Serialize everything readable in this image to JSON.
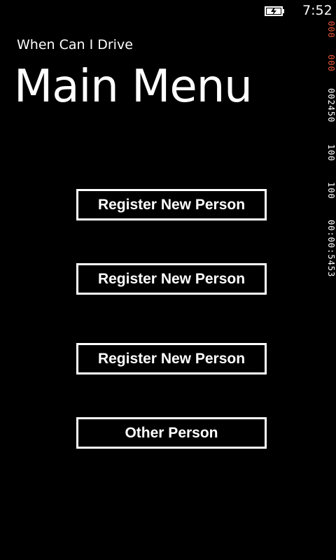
{
  "status_bar": {
    "time": "7:52",
    "battery_icon": "battery-charging-icon"
  },
  "perf_counters": {
    "values": [
      "000",
      "000",
      "002450",
      "100",
      "100",
      "00:00:5453"
    ],
    "colors": {
      "warning": "#e8553a",
      "normal": "#ffffff"
    }
  },
  "header": {
    "app_title": "When Can I Drive",
    "page_title": "Main Menu"
  },
  "menu": {
    "buttons": [
      {
        "label": "Register New Person"
      },
      {
        "label": "Register New Person"
      },
      {
        "label": "Register New Person"
      },
      {
        "label": "Other Person"
      }
    ]
  },
  "theme": {
    "background": "#000000",
    "foreground": "#ffffff"
  }
}
